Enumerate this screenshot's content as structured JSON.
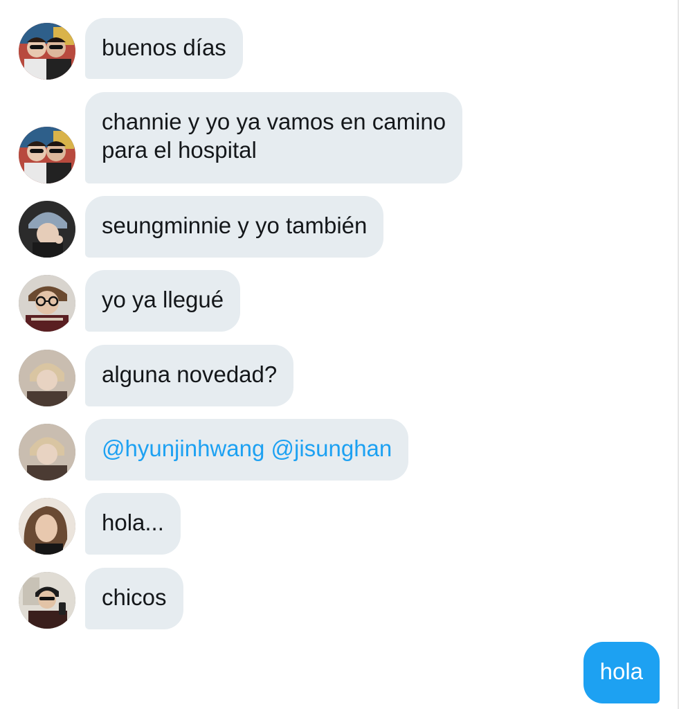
{
  "messages": [
    {
      "sender_avatar": "avatar-duo-sunglasses",
      "text": "buenos días",
      "kind": "incoming"
    },
    {
      "sender_avatar": "avatar-duo-sunglasses",
      "text": "channie y yo ya vamos en camino\npara el hospital",
      "kind": "incoming"
    },
    {
      "sender_avatar": "avatar-beanie",
      "text": "seungminnie y yo también",
      "kind": "incoming"
    },
    {
      "sender_avatar": "avatar-glasses-scarf",
      "text": "yo ya llegué",
      "kind": "incoming"
    },
    {
      "sender_avatar": "avatar-blond",
      "text": "alguna novedad?",
      "kind": "incoming"
    },
    {
      "sender_avatar": "avatar-blond",
      "text": "@hyunjinhwang @jisunghan",
      "kind": "incoming-mention"
    },
    {
      "sender_avatar": "avatar-long-hair",
      "text": "hola...",
      "kind": "incoming"
    },
    {
      "sender_avatar": "avatar-mirror-selfie",
      "text": "chicos",
      "kind": "incoming"
    },
    {
      "text": "hola",
      "kind": "outgoing"
    }
  ],
  "colors": {
    "incoming_bubble": "#e6ecf0",
    "outgoing_bubble": "#1da1f2",
    "mention_text": "#1da1f2",
    "text": "#14171a"
  }
}
